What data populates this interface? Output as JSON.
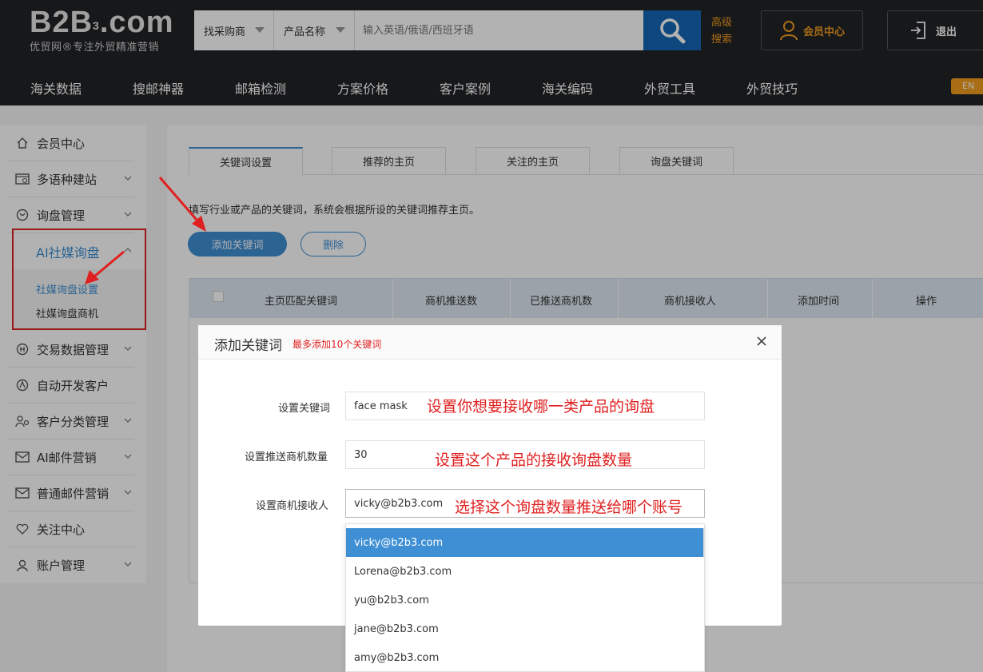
{
  "header": {
    "logo_main": "B2B",
    "logo_sup": "3",
    "logo_domain": ".com",
    "logo_sub": "优贸网®专注外贸精准营销",
    "search": {
      "type_select": "找采购商",
      "field_select": "产品名称",
      "placeholder": "输入英语/俄语/西班牙语"
    },
    "advanced_search": "高级搜索",
    "member_center": "会员中心",
    "logout": "退出",
    "lang_badge": "EN"
  },
  "nav": [
    "海关数据",
    "搜邮神器",
    "邮箱检测",
    "方案价格",
    "客户案例",
    "海关编码",
    "外贸工具",
    "外贸技巧"
  ],
  "sidebar": {
    "items": [
      {
        "label": "会员中心",
        "icon": "home-icon"
      },
      {
        "label": "多语种建站",
        "icon": "website-icon"
      },
      {
        "label": "询盘管理",
        "icon": "inquiry-icon"
      },
      {
        "label": "AI社媒询盘",
        "icon": "none"
      },
      {
        "label": "交易数据管理",
        "icon": "trade-data-icon"
      },
      {
        "label": "自动开发客户",
        "icon": "auto-dev-icon"
      },
      {
        "label": "客户分类管理",
        "icon": "customer-class-icon"
      },
      {
        "label": "AI邮件营销",
        "icon": "mail-icon"
      },
      {
        "label": "普通邮件营销",
        "icon": "mail-icon"
      },
      {
        "label": "关注中心",
        "icon": "heart-icon"
      },
      {
        "label": "账户管理",
        "icon": "user-icon"
      }
    ],
    "sub_items": [
      "社媒询盘设置",
      "社媒询盘商机"
    ]
  },
  "main": {
    "tabs": [
      "关键词设置",
      "推荐的主页",
      "关注的主页",
      "询盘关键词"
    ],
    "hint": "填写行业或产品的关键词，系统会根据所设的关键词推荐主页。",
    "add_button": "添加关键词",
    "delete_button": "删除",
    "table_headers": [
      "主页匹配关键词",
      "商机推送数",
      "已推送商机数",
      "商机接收人",
      "添加时间",
      "操作"
    ]
  },
  "modal": {
    "title": "添加关键词",
    "subtitle": "最多添加10个关键词",
    "fields": [
      {
        "label": "设置关键词",
        "value": "face mask",
        "annotation": "设置你想要接收哪一类产品的询盘"
      },
      {
        "label": "设置推送商机数量",
        "value": "30",
        "annotation": "设置这个产品的接收询盘数量"
      },
      {
        "label": "设置商机接收人",
        "value": "vicky@b2b3.com",
        "annotation": "选择这个询盘数量推送给哪个账号"
      }
    ],
    "dropdown_options": [
      "vicky@b2b3.com",
      "Lorena@b2b3.com",
      "yu@b2b3.com",
      "jane@b2b3.com",
      "amy@b2b3.com"
    ],
    "dropdown_selected_index": 0
  },
  "colors": {
    "header_bg": "#222326",
    "accent_blue": "#3e8fd3",
    "search_blue": "#1565b5",
    "orange": "#f29c1f",
    "annotation_red": "#e02020"
  }
}
